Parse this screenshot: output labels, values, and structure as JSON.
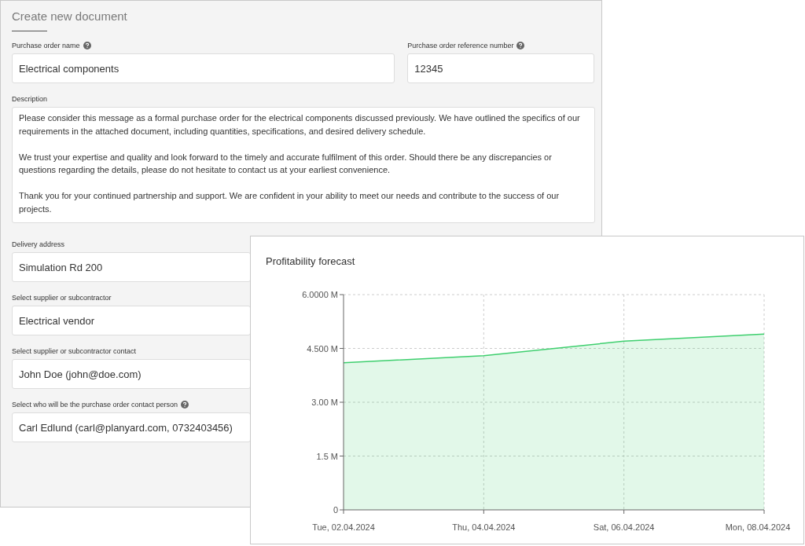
{
  "form": {
    "title": "Create new document",
    "fields": [
      {
        "label": "Purchase order name",
        "help": true,
        "kind": "input",
        "value": "Electrical components"
      },
      {
        "label": "Purchase order reference number",
        "help": true,
        "kind": "input",
        "value": "12345"
      },
      {
        "label": "Description",
        "kind": "textarea",
        "paragraphs": [
          "Please consider this message as a formal purchase order for the electrical components discussed previously. We have outlined the specifics of our requirements in the attached document, including quantities, specifications, and desired delivery schedule.",
          "We trust your expertise and quality and look forward to the timely and accurate fulfilment of this order. Should there be any discrepancies or questions regarding the details, please do not hesitate to contact us at your earliest convenience.",
          "Thank you for your continued partnership and support. We are confident in your ability to meet our needs and contribute to the success of our projects."
        ]
      },
      {
        "label": "Delivery address",
        "kind": "input",
        "value": "Simulation Rd 200"
      },
      {
        "label": "Select supplier or subcontractor",
        "kind": "input",
        "value": "Electrical vendor"
      },
      {
        "label": "Select supplier or subcontractor contact",
        "kind": "input",
        "value": "John Doe (john@doe.com)"
      },
      {
        "label": "Select who will be the purchase order contact person",
        "help": true,
        "kind": "input",
        "value": "Carl Edlund (carl@planyard.com, 0732403456)"
      }
    ]
  },
  "chart_card": {
    "chart_data": {
      "type": "area",
      "title": "Profitability forecast",
      "grid": true,
      "categories": [
        "Tue, 02.04.2024",
        "Thu, 04.04.2024",
        "Sat, 06.04.2024",
        "Mon, 08.04.2024"
      ],
      "series": [
        {
          "color": "#3ecf6e",
          "values": [
            4.1,
            4.3,
            4.7,
            4.9
          ]
        }
      ],
      "ylim": [
        0,
        6
      ],
      "yticks": [
        {
          "value": 0,
          "label": "0"
        },
        {
          "value": 1.5,
          "label": "1.5 M"
        },
        {
          "value": 3,
          "label": "3.00 M"
        },
        {
          "value": 4.5,
          "label": "4.500 M"
        },
        {
          "value": 6,
          "label": "6.0000 M"
        }
      ]
    }
  }
}
